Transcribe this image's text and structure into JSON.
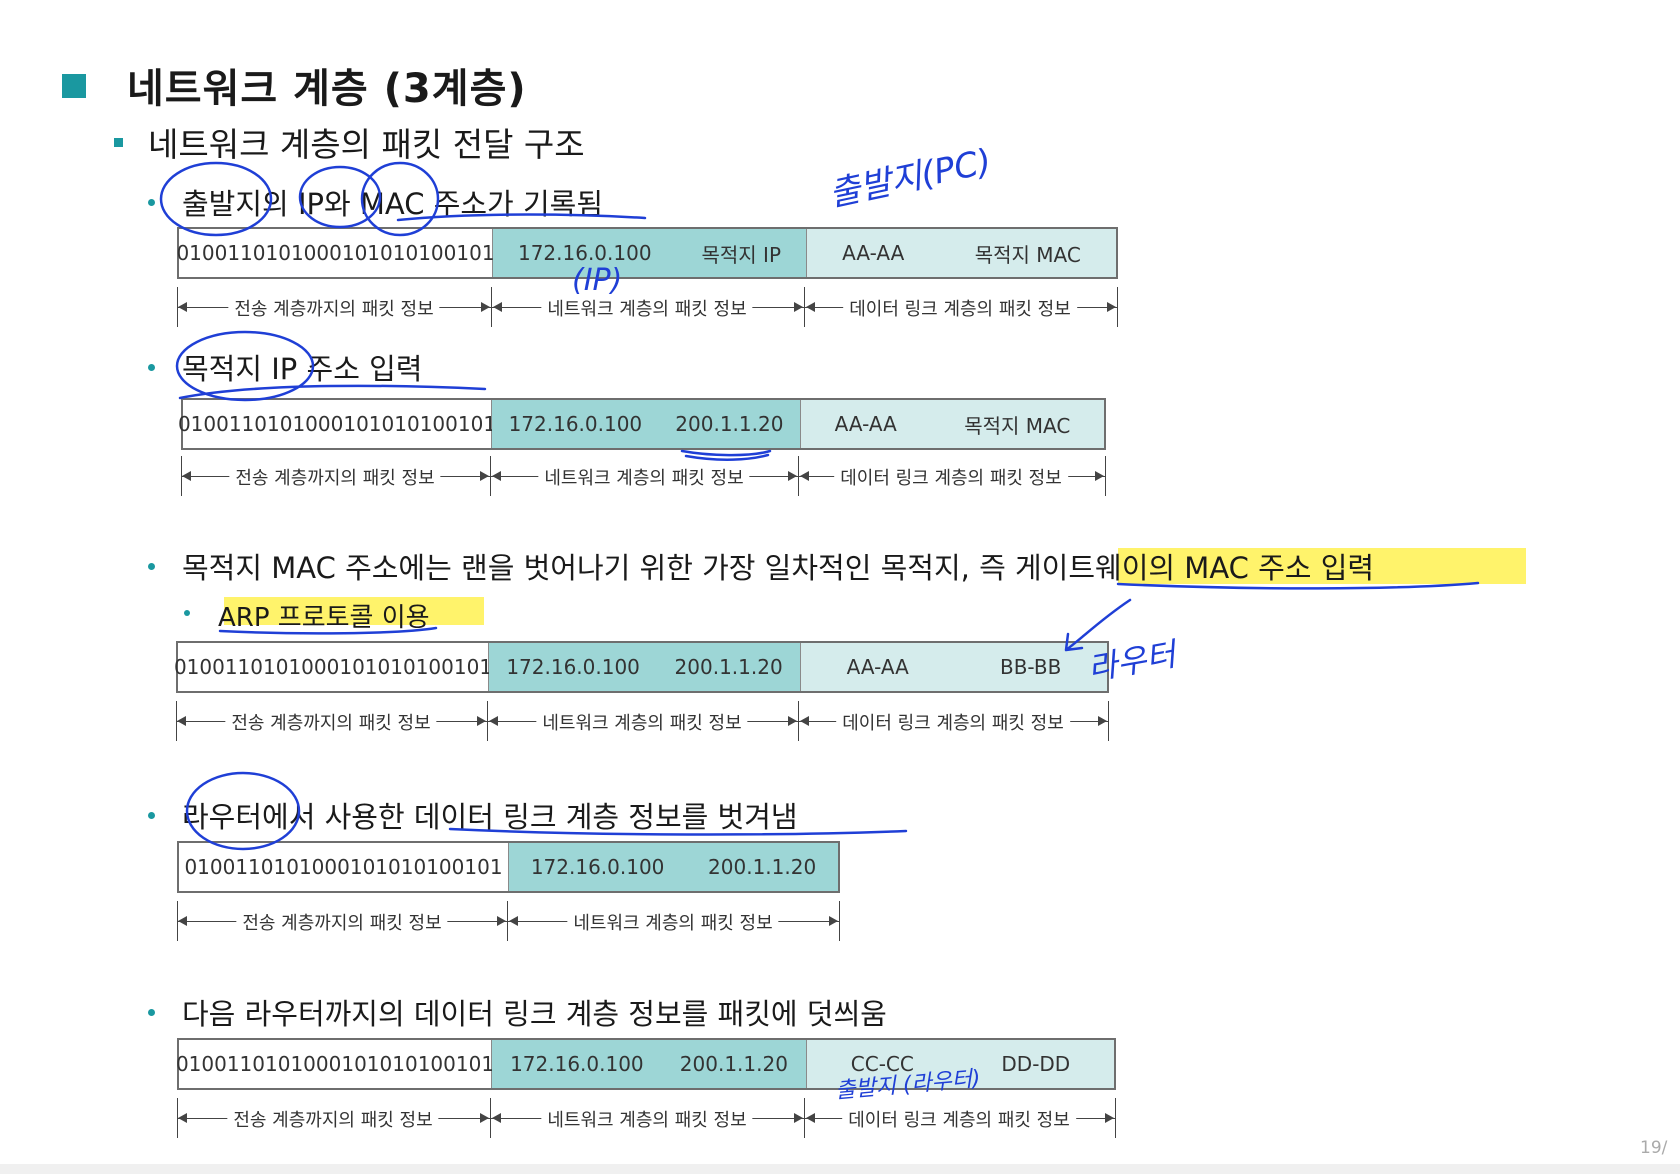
{
  "title": "네트워크 계층 (3계층)",
  "subtitle": "네트워크 계층의 패킷 전달 구조",
  "bullets": {
    "b1": "출발지의 IP와 MAC 주소가 기록됨",
    "b2": "목적지 IP 주소 입력",
    "b3": "목적지 MAC 주소에는 랜을 벗어나기 위한 가장 일차적인 목적지, 즉 게이트웨이의 MAC 주소 입력",
    "b3_sub": "ARP 프로토콜 이용",
    "b4": "라우터에서 사용한 데이터 링크 계층 정보를 벗겨냄",
    "b5": "다음 라우터까지의 데이터 링크 계층 정보를 패킷에 덧씌움"
  },
  "packets": {
    "p1": {
      "data": "01001101010001010101001​01",
      "src_ip": "172.16.0.100",
      "dst_ip": "목적지 IP",
      "src_mac": "AA-AA",
      "dst_mac": "목적지 MAC"
    },
    "p2": {
      "data": "010011010100010101010010​1",
      "src_ip": "172.16.0.100",
      "dst_ip": "200.1.1.20",
      "src_mac": "AA-AA",
      "dst_mac": "목적지 MAC"
    },
    "p3": {
      "data": "0100110101000101010100101",
      "src_ip": "172.16.0.100",
      "dst_ip": "200.1.1.20",
      "src_mac": "AA-AA",
      "dst_mac": "BB-BB"
    },
    "p4": {
      "data": "0100110101000101010100101",
      "src_ip": "172.16.0.100",
      "dst_ip": "200.1.1.20"
    },
    "p5": {
      "data": "0100110101000101010100101",
      "src_ip": "172.16.0.100",
      "dst_ip": "200.1.1.20",
      "src_mac": "CC-CC",
      "dst_mac": "DD-DD"
    }
  },
  "layers": {
    "transport": "전송 계층까지의 패킷 정보",
    "network": "네트워크 계층의 패킷 정보",
    "datalink": "데이터 링크 계층의 패킷 정보"
  },
  "annotations": {
    "a1": "출발지(PC)",
    "a2": "(IP)",
    "a3": "라우터",
    "a4": "출발지 (라우터)"
  },
  "page_number": "19/",
  "colors": {
    "accent": "#1a98a0",
    "network_fill": "#9dd6d6",
    "datalink_fill": "#d5ecec",
    "ink": "#1f3fd6",
    "highlight": "#fff36b"
  }
}
